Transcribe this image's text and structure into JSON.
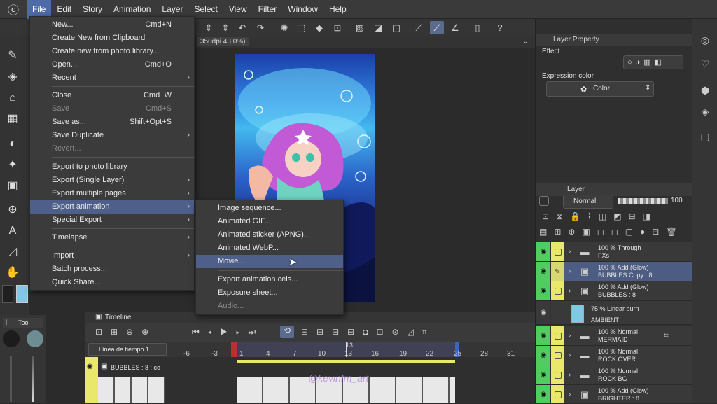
{
  "menubar": {
    "logo": "logo-icon",
    "items": [
      "File",
      "Edit",
      "Story",
      "Animation",
      "Layer",
      "Select",
      "View",
      "Filter",
      "Window",
      "Help"
    ]
  },
  "canvas": {
    "tab_text": "350dpi 43.0%)"
  },
  "file_menu": {
    "items": [
      {
        "label": "New...",
        "shortcut": "Cmd+N"
      },
      {
        "label": "Create New from Clipboard",
        "shortcut": ""
      },
      {
        "label": "Create new from photo library...",
        "shortcut": ""
      },
      {
        "label": "Open...",
        "shortcut": "Cmd+O"
      },
      {
        "label": "Recent",
        "shortcut": ""
      },
      {
        "label": "Close",
        "shortcut": "Cmd+W"
      },
      {
        "label": "Save",
        "shortcut": "Cmd+S"
      },
      {
        "label": "Save as...",
        "shortcut": "Shift+Opt+S"
      },
      {
        "label": "Save Duplicate",
        "shortcut": ""
      },
      {
        "label": "Revert...",
        "shortcut": ""
      },
      {
        "label": "Export to photo library",
        "shortcut": ""
      },
      {
        "label": "Export (Single Layer)",
        "shortcut": ""
      },
      {
        "label": "Export multiple pages",
        "shortcut": ""
      },
      {
        "label": "Export animation",
        "shortcut": ""
      },
      {
        "label": "Special Export",
        "shortcut": ""
      },
      {
        "label": "Timelapse",
        "shortcut": ""
      },
      {
        "label": "Import",
        "shortcut": ""
      },
      {
        "label": "Batch process...",
        "shortcut": ""
      },
      {
        "label": "Quick Share...",
        "shortcut": ""
      }
    ]
  },
  "export_submenu": {
    "items": [
      {
        "label": "Image sequence..."
      },
      {
        "label": "Animated GIF..."
      },
      {
        "label": "Animated sticker (APNG)..."
      },
      {
        "label": "Animated WebP..."
      },
      {
        "label": "Movie..."
      },
      {
        "label": "Export animation cels..."
      },
      {
        "label": "Exposure sheet..."
      },
      {
        "label": "Audio..."
      }
    ]
  },
  "layer_property": {
    "title": "Layer Property",
    "effect_label": "Effect",
    "expression_color_label": "Expression color",
    "expression_color_value": "Color"
  },
  "layer_panel": {
    "title": "Layer",
    "blend_mode": "Normal",
    "opacity": "100",
    "layers": [
      {
        "line1": "100 % Through",
        "line2": "FXs",
        "type": "folder"
      },
      {
        "line1": "100 % Add (Glow)",
        "line2": "BUBBLES Copy : 8",
        "type": "anim-folder"
      },
      {
        "line1": "100 % Add (Glow)",
        "line2": "BUBBLES : 8",
        "type": "anim-folder"
      },
      {
        "line1": "75 % Linear burn",
        "line2": "AMBIENT",
        "type": "fill"
      },
      {
        "line1": "100 % Normal",
        "line2": "MERMAID",
        "type": "folder"
      },
      {
        "line1": "100 % Normal",
        "line2": "ROCK OVER",
        "type": "folder"
      },
      {
        "line1": "100 % Normal",
        "line2": "ROCK BG",
        "type": "folder"
      },
      {
        "line1": "100 % Add (Glow)",
        "line2": "BRIGHTER : 8",
        "type": "anim-folder"
      }
    ]
  },
  "timeline": {
    "title": "Timeline",
    "track_name": "Línea de tiempo 1",
    "layer_label": "BUBBLES : 8 : co",
    "ticks": [
      "-6",
      "-3",
      "1",
      "4",
      "7",
      "10",
      "13",
      "16",
      "19",
      "22",
      "25",
      "28",
      "31"
    ],
    "current_frame_marker": "13",
    "watermark": "@kevinfm_art"
  },
  "left_panel": {
    "tool_tab": "Too"
  }
}
